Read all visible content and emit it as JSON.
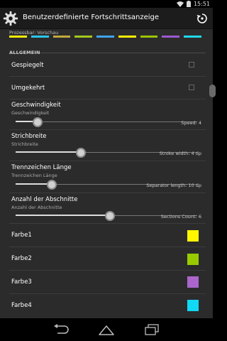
{
  "status": {
    "time": "15:51"
  },
  "header": {
    "title": "Benutzerdefinierte Fortschrittsanzeige"
  },
  "preview": {
    "label": "Prozessbar: Vorschau",
    "colors": [
      "#FFF000",
      "#2BC6F0",
      "#C3A93C",
      "#A3C81C",
      "#3EA5F5",
      "#FFF000",
      "#9CC400",
      "#9B59D0",
      "#20D8F0"
    ]
  },
  "section": {
    "title": "ALLGEMEIN"
  },
  "settings": {
    "mirrored": {
      "label": "Gespiegelt",
      "checked": false
    },
    "reversed": {
      "label": "Umgekehrt",
      "checked": false
    },
    "speed": {
      "label": "Geschwindigkeit",
      "summary": "Geschwindigkeit",
      "value_text": "Speed:  4",
      "fraction": 0.12
    },
    "stroke": {
      "label": "Strichbreite",
      "summary": "Strichbreite",
      "value_text": "Stroke width:  4 dp",
      "fraction": 0.36
    },
    "separator": {
      "label": "Trennzeichen Länge",
      "summary": "Trennzeichen Länge",
      "value_text": "Separator length:  10 dp",
      "fraction": 0.2
    },
    "sections": {
      "label": "Anzahl der Abschnitte",
      "summary": "Anzahl der Abschnitte",
      "value_text": "Sections Count:  6",
      "fraction": 0.52
    }
  },
  "colors": [
    {
      "label": "Farbe1",
      "hex": "#FFF700"
    },
    {
      "label": "Farbe2",
      "hex": "#99CC00"
    },
    {
      "label": "Farbe3",
      "hex": "#AA66CC"
    },
    {
      "label": "Farbe4",
      "hex": "#11D8F5"
    }
  ]
}
